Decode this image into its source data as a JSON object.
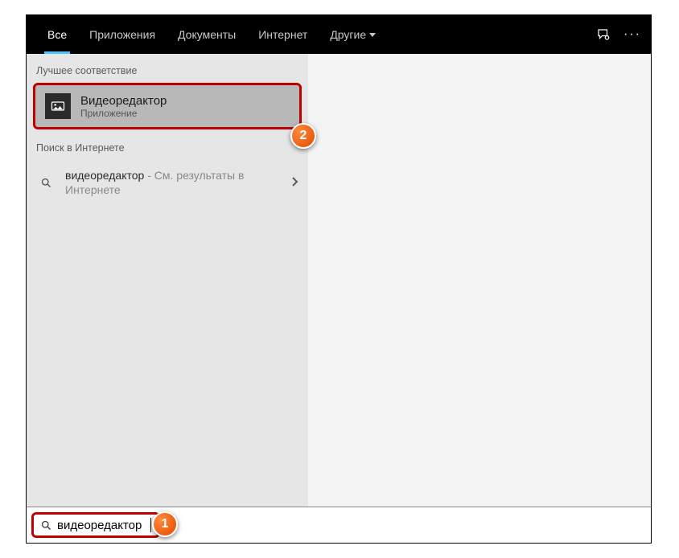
{
  "tabs": {
    "all": "Все",
    "apps": "Приложения",
    "documents": "Документы",
    "internet": "Интернет",
    "other": "Другие"
  },
  "sections": {
    "best_match": "Лучшее соответствие",
    "web_search": "Поиск в Интернете"
  },
  "best_match": {
    "title": "Видеоредактор",
    "subtitle": "Приложение"
  },
  "web_result": {
    "query": "видеоредактор",
    "suffix": " - См. результаты в Интернете"
  },
  "search": {
    "value": "видеоредактор"
  },
  "callouts": {
    "one": "1",
    "two": "2"
  }
}
